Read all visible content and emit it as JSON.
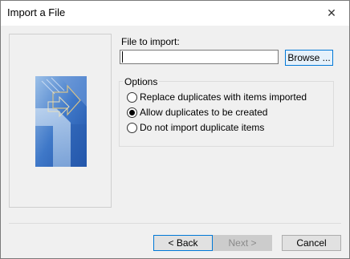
{
  "window": {
    "title": "Import a File"
  },
  "file": {
    "label": "File to import:",
    "value": "",
    "browse_label": "Browse ..."
  },
  "options": {
    "legend": "Options",
    "items": [
      {
        "label": "Replace duplicates with items imported",
        "selected": false
      },
      {
        "label": "Allow duplicates to be created",
        "selected": true
      },
      {
        "label": "Do not import duplicate items",
        "selected": false
      }
    ]
  },
  "footer": {
    "back_label": "< Back",
    "next_label": "Next >",
    "cancel_label": "Cancel"
  },
  "icons": {
    "close": "close-icon",
    "wizard_art": "import-wizard-graphic"
  }
}
